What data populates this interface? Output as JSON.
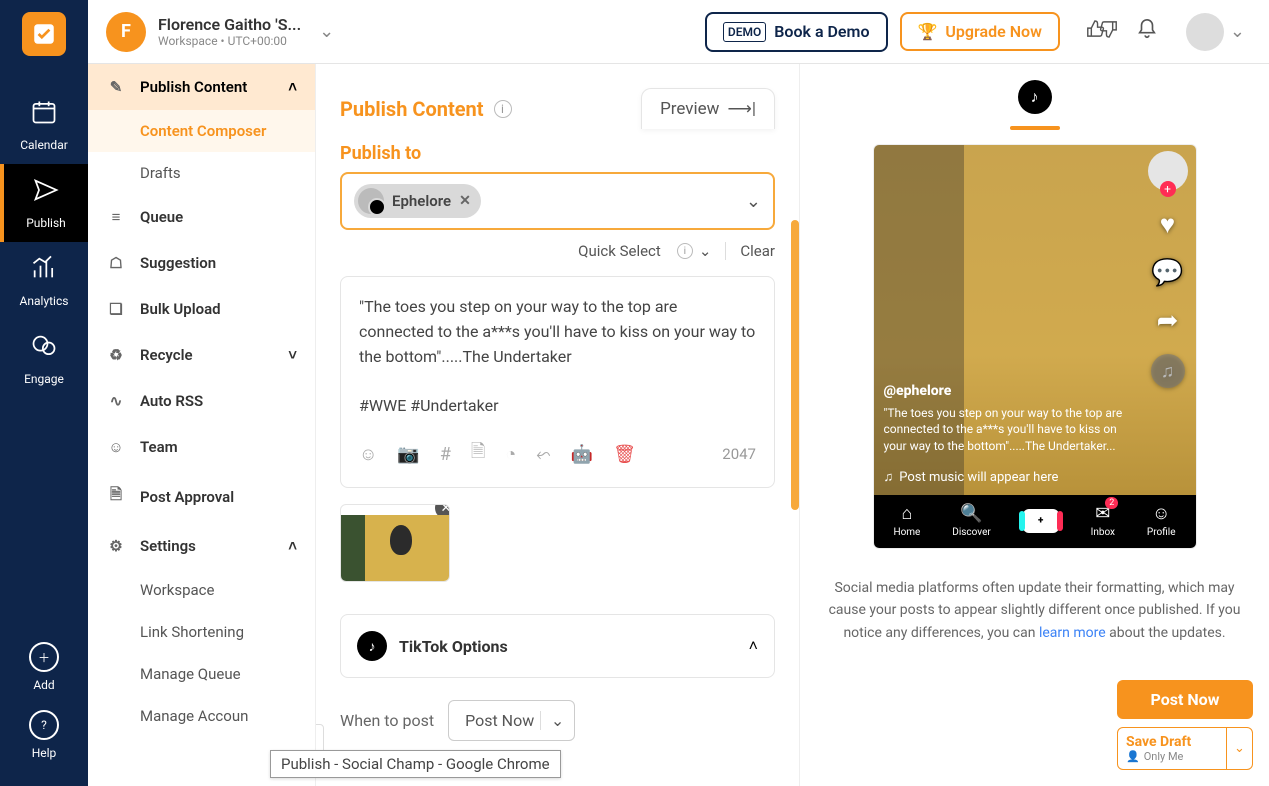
{
  "rail": {
    "items": [
      {
        "label": "Calendar"
      },
      {
        "label": "Publish"
      },
      {
        "label": "Analytics"
      },
      {
        "label": "Engage"
      }
    ],
    "add": "Add",
    "help": "Help"
  },
  "topbar": {
    "avatar_letter": "F",
    "workspace_name": "Florence Gaitho 'S...",
    "workspace_meta": "Workspace • UTC+00:00",
    "demo": "Book a Demo",
    "upgrade": "Upgrade Now"
  },
  "sidebar": {
    "publish_content": "Publish Content",
    "items": [
      {
        "label": "Content Composer"
      },
      {
        "label": "Drafts"
      },
      {
        "label": "Queue"
      },
      {
        "label": "Suggestion"
      },
      {
        "label": "Bulk Upload"
      },
      {
        "label": "Recycle"
      },
      {
        "label": "Auto RSS"
      },
      {
        "label": "Team"
      },
      {
        "label": "Post Approval"
      },
      {
        "label": "Settings"
      }
    ],
    "settings_children": [
      {
        "label": "Workspace"
      },
      {
        "label": "Link Shortening"
      },
      {
        "label": "Manage Queue"
      },
      {
        "label": "Manage Accoun"
      }
    ]
  },
  "content": {
    "title": "Publish Content",
    "preview": "Preview",
    "publish_to": "Publish to",
    "account_name": "Ephelore",
    "quick_select": "Quick Select",
    "clear": "Clear",
    "post_text": "\"The toes you step on your way to the top are connected to the a***s you'll have to kiss on your way to the bottom\".....The Undertaker\n\n#WWE #Undertaker",
    "char_count": "2047",
    "options_title": "TikTok Options",
    "when_label": "When to post",
    "when_value": "Post Now"
  },
  "preview_panel": {
    "handle": "@ephelore",
    "caption": "\"The toes you step on your way to the top are connected to the a***s you'll have to kiss on your way to the bottom\".....The Undertaker...",
    "music": "Post music will appear here",
    "nav": {
      "home": "Home",
      "discover": "Discover",
      "inbox": "Inbox",
      "profile": "Profile"
    },
    "note_1": "Social media platforms often update their formatting, which may cause your posts to appear slightly different once published. If you notice any differences, you can ",
    "note_link": "learn more",
    "note_2": " about the updates."
  },
  "actions": {
    "post": "Post Now",
    "save": "Save Draft",
    "only_me": "Only Me"
  },
  "tooltip": "Publish - Social Champ - Google Chrome"
}
